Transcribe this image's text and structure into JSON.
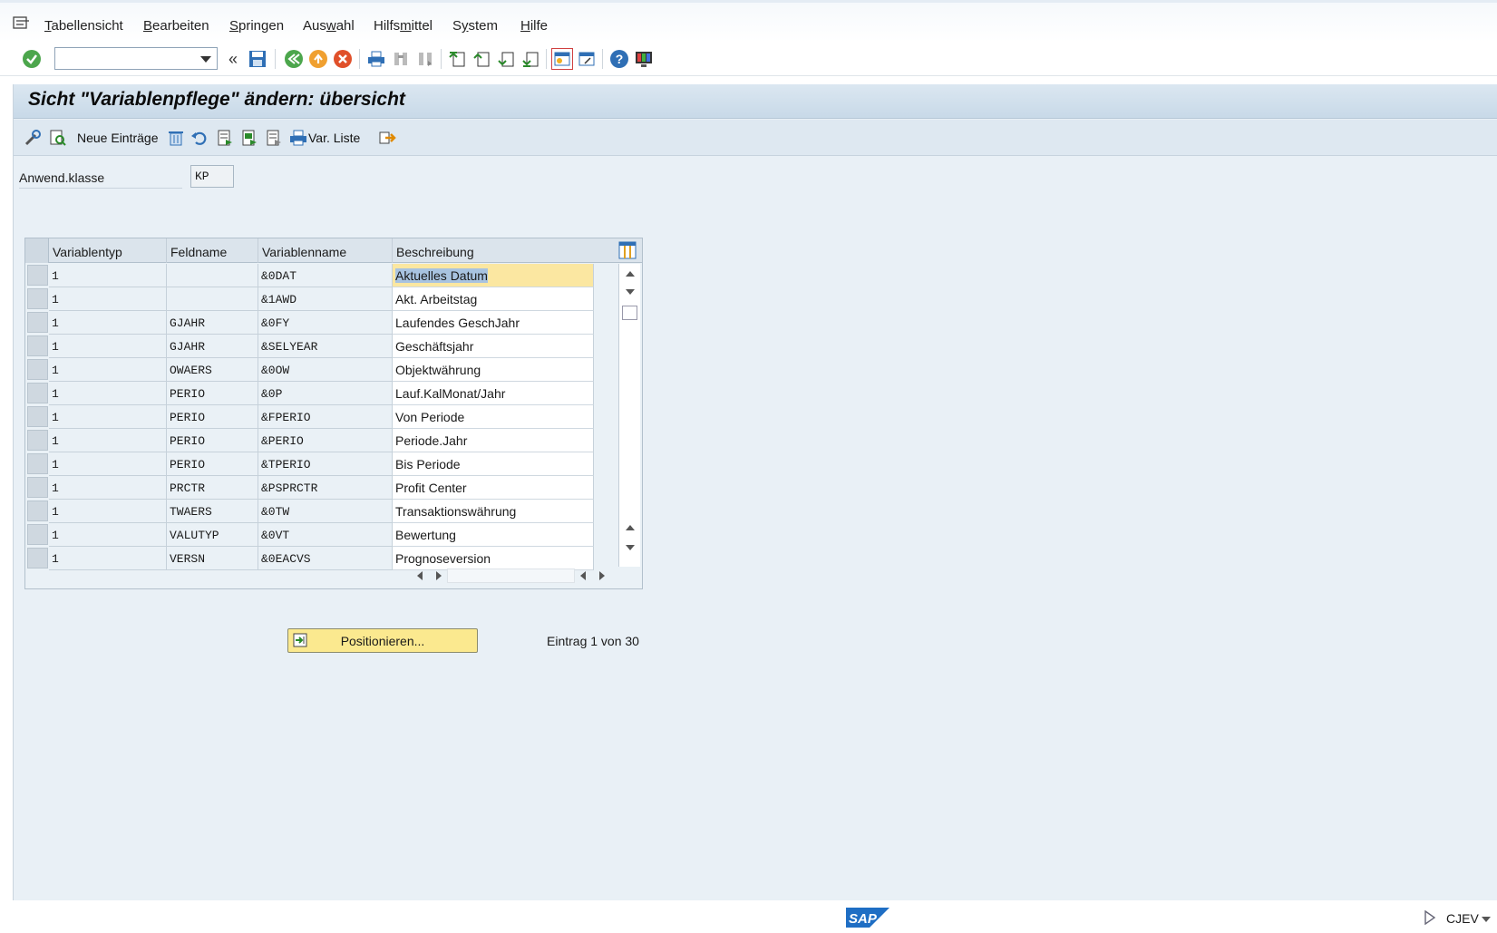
{
  "menu": {
    "items": [
      {
        "label": "Tabellensicht",
        "key": "T"
      },
      {
        "label": "Bearbeiten",
        "key": "B"
      },
      {
        "label": "Springen",
        "key": "S"
      },
      {
        "label": "Auswahl",
        "key": "w"
      },
      {
        "label": "Hilfsmittel",
        "key": "m"
      },
      {
        "label": "System",
        "key": "y"
      },
      {
        "label": "Hilfe",
        "key": "H"
      }
    ]
  },
  "toolbar": {
    "command_value": "",
    "collapse_symbol": "«"
  },
  "screen": {
    "title": "Sicht \"Variablenpflege\" ändern: übersicht"
  },
  "app_toolbar": {
    "new_entries": "Neue Einträge",
    "var_list": "Var. Liste"
  },
  "field": {
    "label": "Anwend.klasse",
    "value": "KP"
  },
  "table": {
    "headers": [
      "Variablentyp",
      "Feldname",
      "Variablenname",
      "Beschreibung"
    ],
    "rows": [
      {
        "typ": "1",
        "feld": "",
        "var": "&0DAT",
        "desc": "Aktuelles Datum"
      },
      {
        "typ": "1",
        "feld": "",
        "var": "&1AWD",
        "desc": "Akt. Arbeitstag"
      },
      {
        "typ": "1",
        "feld": "GJAHR",
        "var": "&0FY",
        "desc": "Laufendes GeschJahr"
      },
      {
        "typ": "1",
        "feld": "GJAHR",
        "var": "&SELYEAR",
        "desc": "Geschäftsjahr"
      },
      {
        "typ": "1",
        "feld": "OWAERS",
        "var": "&0OW",
        "desc": "Objektwährung"
      },
      {
        "typ": "1",
        "feld": "PERIO",
        "var": "&0P",
        "desc": "Lauf.KalMonat/Jahr"
      },
      {
        "typ": "1",
        "feld": "PERIO",
        "var": "&FPERIO",
        "desc": "Von Periode"
      },
      {
        "typ": "1",
        "feld": "PERIO",
        "var": "&PERIO",
        "desc": "Periode.Jahr"
      },
      {
        "typ": "1",
        "feld": "PERIO",
        "var": "&TPERIO",
        "desc": "Bis Periode"
      },
      {
        "typ": "1",
        "feld": "PRCTR",
        "var": "&PSPRCTR",
        "desc": "Profit Center"
      },
      {
        "typ": "1",
        "feld": "TWAERS",
        "var": "&0TW",
        "desc": "Transaktionswährung"
      },
      {
        "typ": "1",
        "feld": "VALUTYP",
        "var": "&0VT",
        "desc": "Bewertung"
      },
      {
        "typ": "1",
        "feld": "VERSN",
        "var": "&0EACVS",
        "desc": "Prognoseversion"
      }
    ]
  },
  "position_button": "Positionieren...",
  "entry_info": "Eintrag 1 von 30",
  "status": {
    "logo": "SAP",
    "system": "CJEV"
  },
  "colors": {
    "work_area": "#e9f0f6",
    "title_bar": "#c8d9e8",
    "highlight": "#fbe7a1",
    "button": "#fbe98f"
  },
  "icons": [
    "menu-icon",
    "check-icon",
    "save-icon",
    "back-icon",
    "exit-icon",
    "cancel-icon",
    "print-icon",
    "find-icon",
    "find-next-icon",
    "first-page-icon",
    "prev-page-icon",
    "next-page-icon",
    "last-page-icon",
    "new-session-icon",
    "shortcut-icon",
    "help-icon",
    "customize-icon"
  ]
}
